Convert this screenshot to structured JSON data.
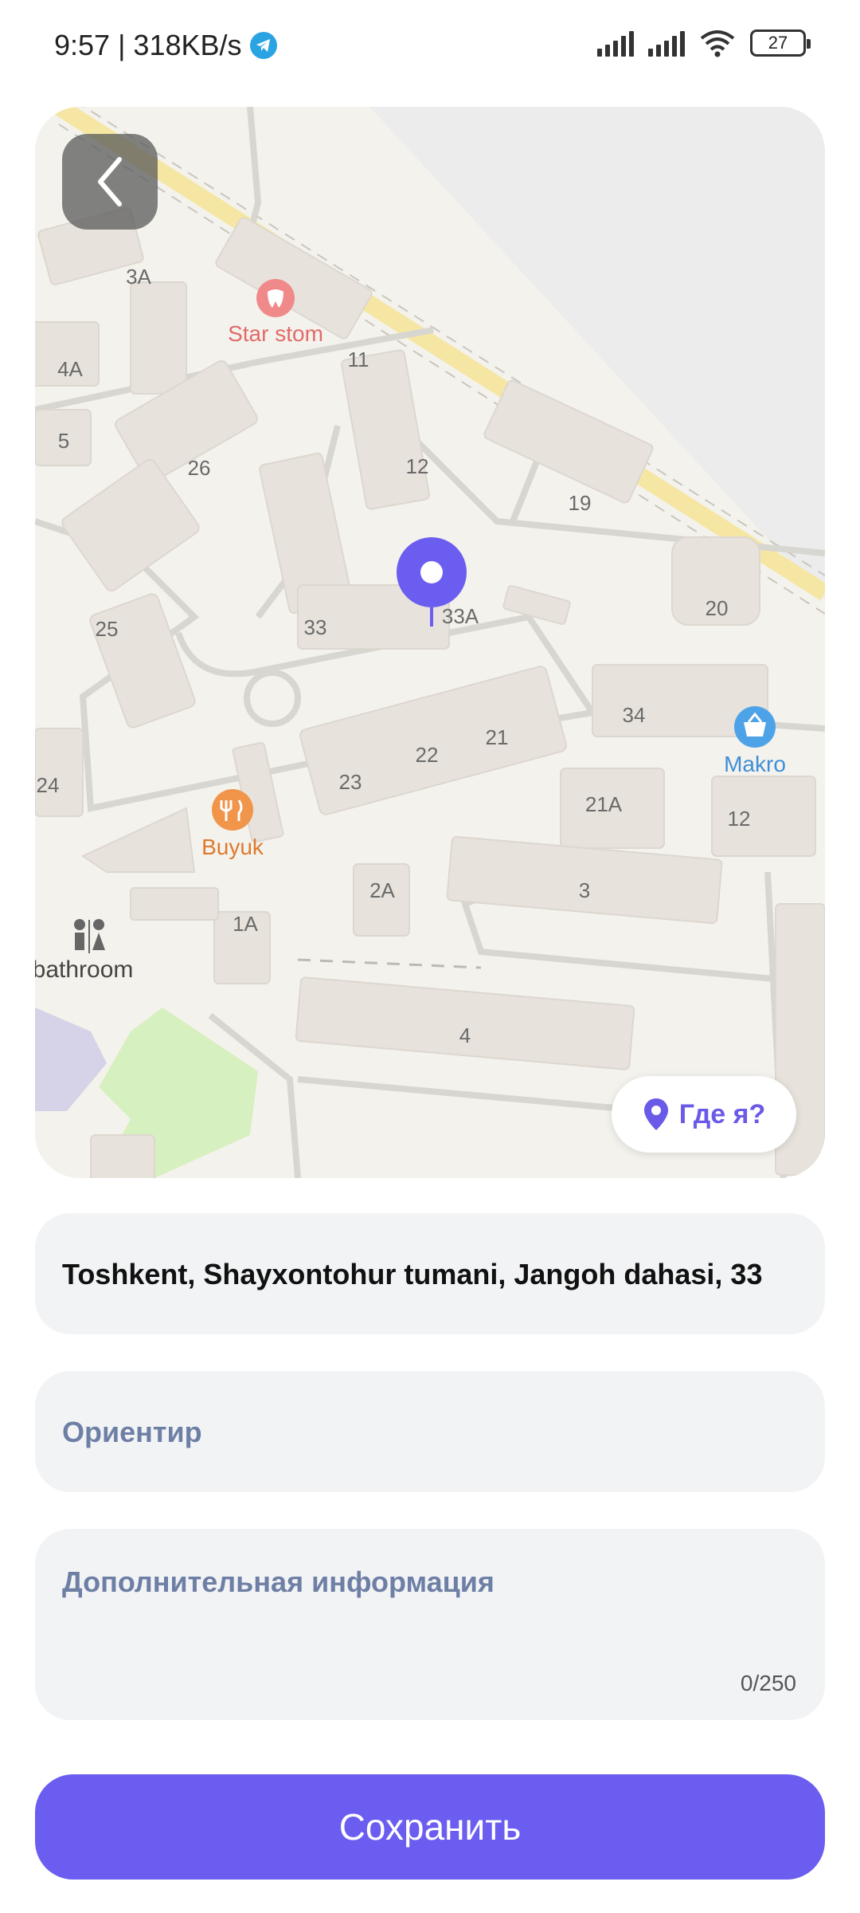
{
  "status_bar": {
    "time": "9:57",
    "speed": "| 318KB/s",
    "battery": "27",
    "icons": [
      "telegram-icon",
      "signal-icon",
      "signal-icon",
      "wifi-icon",
      "battery-icon"
    ]
  },
  "map": {
    "labels": {
      "b3a": "3A",
      "b4a": "4A",
      "b5": "5",
      "b26": "26",
      "b25": "25",
      "b24": "24",
      "b11": "11",
      "b12": "12",
      "b19": "19",
      "b20": "20",
      "b33": "33",
      "b33a": "33A",
      "b34": "34",
      "b22": "22",
      "b21": "21",
      "b23": "23",
      "b21a": "21A",
      "b12b": "12",
      "b2a": "2A",
      "b3": "3",
      "b1a": "1A",
      "b4": "4"
    },
    "pois": {
      "star_stom": "Star stom",
      "makro": "Makro",
      "buyuk": "Buyuk",
      "bathroom": "lic bathroom"
    },
    "where_label": "Где я?"
  },
  "form": {
    "address": "Toshkent, Shayxontohur tumani, Jangoh dahasi, 33",
    "landmark_placeholder": "Ориентир",
    "info_placeholder": "Дополнительная информация",
    "counter": "0/250",
    "save_label": "Сохранить"
  },
  "colors": {
    "accent": "#6b5df0",
    "field_bg": "#f2f3f5",
    "placeholder": "#6e7fa5"
  }
}
